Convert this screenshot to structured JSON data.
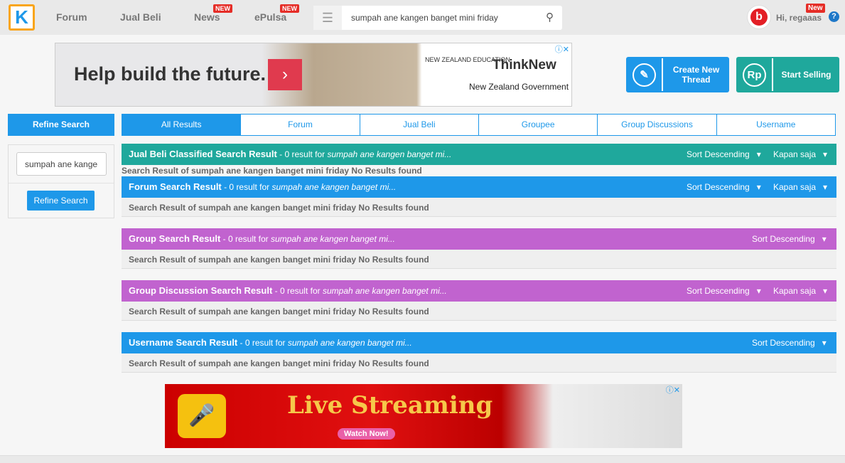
{
  "header": {
    "logo": "K",
    "nav": [
      {
        "label": "Forum"
      },
      {
        "label": "Jual Beli"
      },
      {
        "label": "News",
        "badge": "NEW"
      },
      {
        "label": "ePulsa",
        "badge": "NEW"
      }
    ],
    "search_value": "sumpah ane kangen banget mini friday",
    "user_greeting": "Hi, regaaas",
    "user_badge": "New",
    "help": "?"
  },
  "ad_top": {
    "headline": "Help build the future.",
    "brand1": "NEW ZEALAND EDUCATION",
    "brand2": "ThinkNew",
    "brand3": "New Zealand Government"
  },
  "actions": {
    "create": "Create New Thread",
    "sell": "Start Selling",
    "rp": "Rp"
  },
  "sidebar": {
    "title": "Refine Search",
    "input_value": "sumpah ane kangen banget mini friday",
    "button": "Refine Search"
  },
  "tabs": [
    "All Results",
    "Forum",
    "Jual Beli",
    "Groupee",
    "Group Discussions",
    "Username"
  ],
  "sort_label": "Sort Descending",
  "time_label": "Kapan saja",
  "sections": [
    {
      "title": "Jual Beli Classified Search Result",
      "summary": " - 0 result for ",
      "query": "sumpah ane kangen banget mi...",
      "body": "Search Result of sumpah ane kangen banget mini friday No Results found",
      "color": "#1fa89c"
    },
    {
      "title": "Forum Search Result",
      "summary": " - 0 result for ",
      "query": "sumpah ane kangen banget mi...",
      "body": "Search Result of sumpah ane kangen banget mini friday No Results found",
      "color": "#1e98e9"
    },
    {
      "title": "Group Search Result",
      "summary": " - 0 result for ",
      "query": "sumpah ane kangen banget mi...",
      "body": "Search Result of sumpah ane kangen banget mini friday No Results found",
      "color": "#c163cf"
    },
    {
      "title": "Group Discussion Search Result",
      "summary": " - 0 result for ",
      "query": "sumpah ane kangen banget mi...",
      "body": "Search Result of sumpah ane kangen banget mini friday No Results found",
      "color": "#c163cf"
    },
    {
      "title": "Username Search Result",
      "summary": " - 0 result for ",
      "query": "sumpah ane kangen banget mi...",
      "body": "Search Result of sumpah ane kangen banget mini friday No Results found",
      "color": "#1e98e9"
    }
  ],
  "ad_bottom": {
    "headline": "Live Streaming",
    "cta": "Watch Now!"
  }
}
